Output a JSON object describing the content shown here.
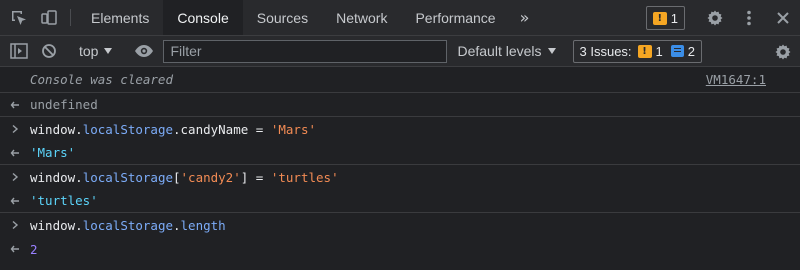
{
  "tabs": [
    {
      "label": "Elements",
      "active": false
    },
    {
      "label": "Console",
      "active": true
    },
    {
      "label": "Sources",
      "active": false
    },
    {
      "label": "Network",
      "active": false
    },
    {
      "label": "Performance",
      "active": false
    }
  ],
  "top_issues_count": "1",
  "toolbar": {
    "context": "top",
    "filter_placeholder": "Filter",
    "filter_value": "",
    "levels_label": "Default levels",
    "issues_label": "3 Issues:",
    "warning_count": "1",
    "info_count": "2"
  },
  "console": {
    "cleared_text": "Console was cleared",
    "cleared_source": "VM1647:1",
    "undefined_result": "undefined",
    "cmd1": {
      "obj": "window",
      "prop1": "localStorage",
      "prop2": "candyName",
      "op": " = ",
      "value": "'Mars'"
    },
    "res1": "'Mars'",
    "cmd2": {
      "obj": "window",
      "prop1": "localStorage",
      "key": "'candy2'",
      "op": " = ",
      "value": "'turtles'"
    },
    "res2": "'turtles'",
    "cmd3": {
      "obj": "window",
      "prop1": "localStorage",
      "prop2": "length"
    },
    "res3": "2"
  },
  "colors": {
    "warning": "#f5a623",
    "info": "#3b8ee8",
    "string": "#f28b54",
    "string_result": "#5cd5fb",
    "property": "#7cacf8",
    "number": "#9980ff"
  },
  "icons": [
    "inspect-element-icon",
    "device-toolbar-icon",
    "more-tabs-icon",
    "warning-flag-icon",
    "settings-gear-icon",
    "more-options-icon",
    "close-icon",
    "sidebar-toggle-icon",
    "clear-console-icon",
    "eye-icon",
    "message-icon",
    "input-prompt-icon",
    "result-arrow-icon"
  ]
}
